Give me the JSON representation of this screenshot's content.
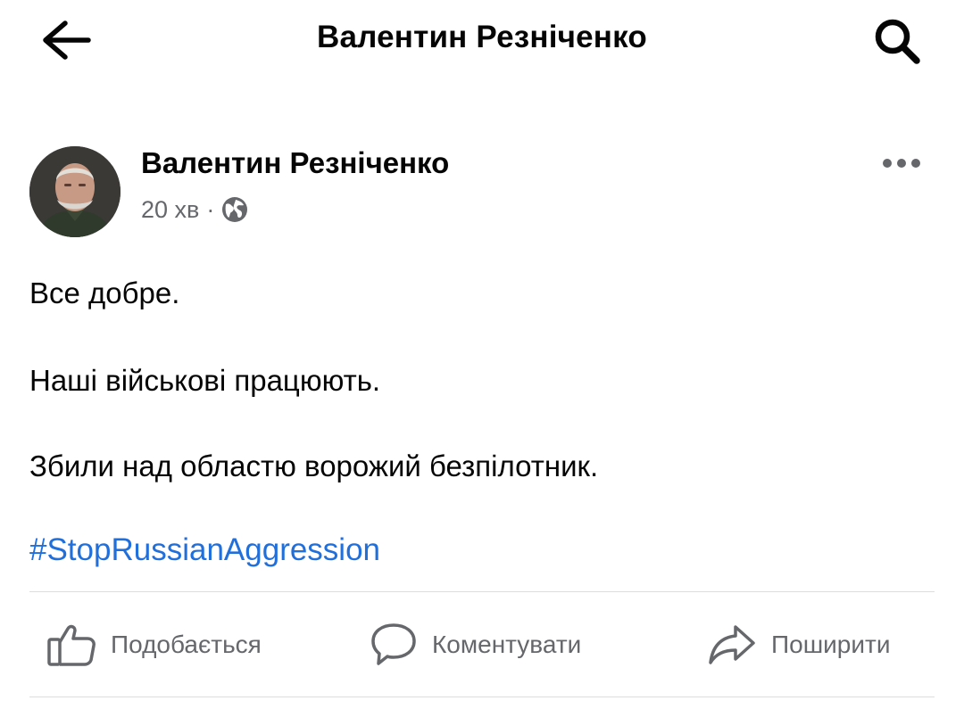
{
  "header": {
    "title": "Валентин Резніченко",
    "back_icon": "arrow-left-icon",
    "search_icon": "search-icon"
  },
  "post": {
    "author": "Валентин Резніченко",
    "time": "20 хв",
    "separator": "·",
    "privacy_icon": "globe-icon",
    "more_icon": "more-horizontal-icon",
    "paragraphs": [
      "Все добре.",
      "Наші військові працюють.",
      "Збили над областю ворожий безпілотник."
    ],
    "hashtag": "#StopRussianAggression"
  },
  "actions": {
    "like": "Подобається",
    "comment": "Коментувати",
    "share": "Поширити"
  },
  "colors": {
    "text": "#050505",
    "secondary": "#65676b",
    "link": "#216fdb",
    "divider": "#dadde1"
  }
}
